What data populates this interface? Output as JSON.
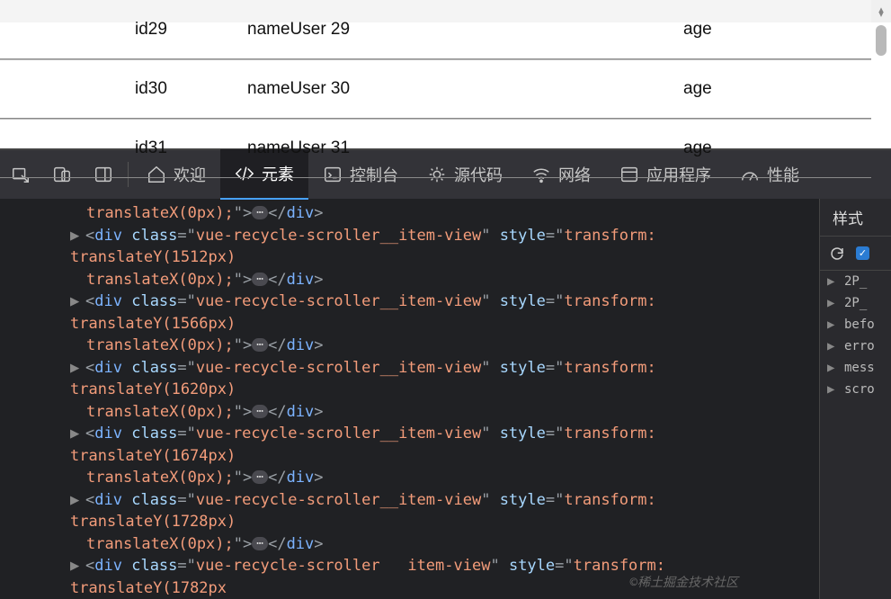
{
  "table": {
    "rows": [
      {
        "id": "id29",
        "name": "nameUser 29",
        "age": "age"
      },
      {
        "id": "id30",
        "name": "nameUser 30",
        "age": "age"
      },
      {
        "id": "id31",
        "name": "nameUser 31",
        "age": "age"
      }
    ]
  },
  "devtools": {
    "tabs": {
      "welcome": "欢迎",
      "elements": "元素",
      "console": "控制台",
      "sources": "源代码",
      "network": "网络",
      "app": "应用程序",
      "perf": "性能"
    },
    "truncated_top": "translateX(0px);\">…</div>",
    "dom_nodes": [
      {
        "translateY": "1512px"
      },
      {
        "translateY": "1566px"
      },
      {
        "translateY": "1620px"
      },
      {
        "translateY": "1674px"
      },
      {
        "translateY": "1728px"
      }
    ],
    "node_common": {
      "tag": "div",
      "class_attr": "class",
      "class_val": "vue-recycle-scroller__item-view",
      "style_attr": "style",
      "style_prefix": "transform: translateY(",
      "style_suffix": ")",
      "cont_line": "translateX(0px);",
      "close_frag": "</div>"
    },
    "last_partial": {
      "tag": "div",
      "class_val_1": "vue-recycle-scroller",
      "class_val_2": "item-view",
      "translateY": "1782px"
    },
    "styles": {
      "header": "样式",
      "rules": [
        "2P_",
        "2P_",
        "befo",
        "erro",
        "mess",
        "scro"
      ]
    },
    "watermark": "©稀土掘金技术社区"
  }
}
